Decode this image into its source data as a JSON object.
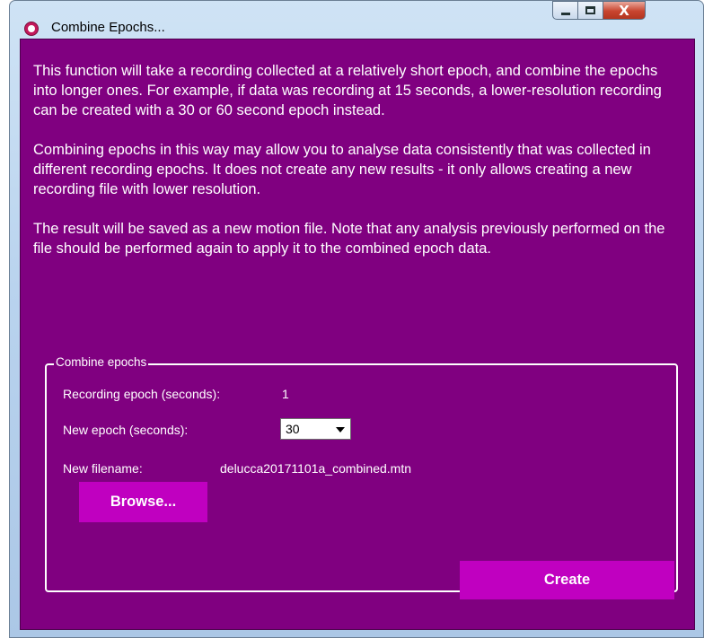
{
  "window": {
    "title": "Combine Epochs...",
    "controls": {
      "minimize": "minimize",
      "maximize": "maximize",
      "close": "X"
    }
  },
  "intro": {
    "p1": "This function will take a recording collected at a relatively short epoch, and combine the epochs into longer ones.  For example, if data was recording at 15 seconds, a lower-resolution recording can be created with a 30 or 60 second epoch instead.",
    "p2": "Combining epochs in this way may allow you to analyse data consistently that was collected in different recording epochs.  It does not create any new results - it only allows creating a new recording file with lower resolution.",
    "p3": "The result will be saved as a new motion file.  Note that any analysis previously performed on the file should be performed again to apply it to the combined epoch data."
  },
  "group": {
    "legend": "Combine epochs",
    "recording_epoch_label": "Recording epoch (seconds):",
    "recording_epoch_value": "1",
    "new_epoch_label": "New epoch (seconds):",
    "new_epoch_selected": "30",
    "new_filename_label": "New filename:",
    "new_filename_value": "delucca20171101a_combined.mtn",
    "browse_button": "Browse...",
    "create_button": "Create"
  },
  "icons": {
    "app": "app-logo-icon",
    "dropdown": "chevron-down-icon"
  },
  "colors": {
    "background": "#800080",
    "button": "#c000c0",
    "text": "#ffffff"
  }
}
